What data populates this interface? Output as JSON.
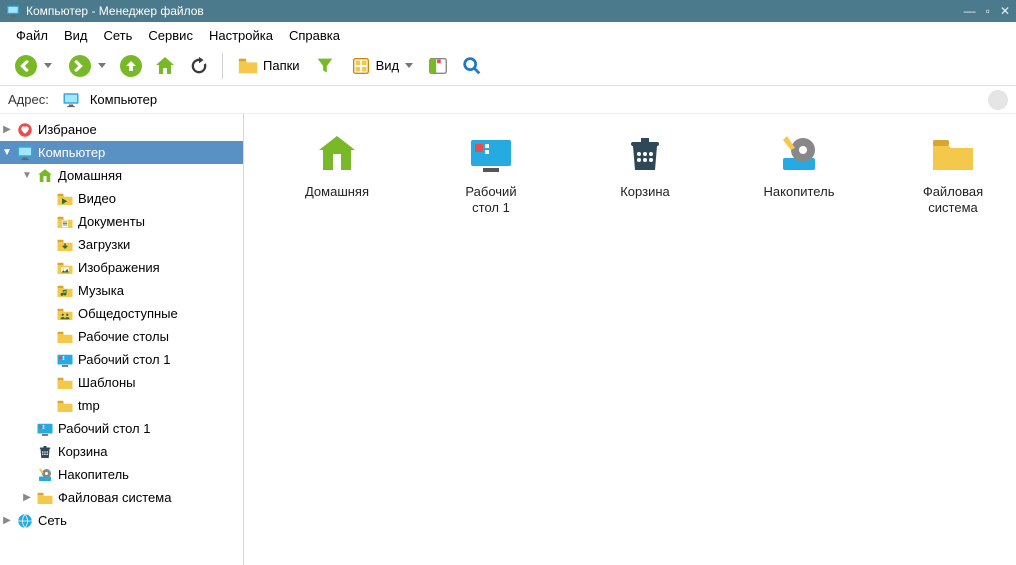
{
  "titlebar": {
    "title": "Компьютер  - Менеджер файлов"
  },
  "menu": {
    "file": "Файл",
    "view": "Вид",
    "net": "Сеть",
    "service": "Сервис",
    "settings": "Настройка",
    "help": "Справка"
  },
  "toolbar": {
    "folders": "Папки",
    "view": "Вид"
  },
  "address": {
    "label": "Адрес:",
    "value": "Компьютер"
  },
  "tree": {
    "favorites": "Избраное",
    "computer": "Компьютер",
    "home": "Домашняя",
    "video": "Видео",
    "documents": "Документы",
    "downloads": "Загрузки",
    "pictures": "Изображения",
    "music": "Музыка",
    "public": "Общедоступные",
    "desktops": "Рабочие столы",
    "desktop1": "Рабочий стол 1",
    "templates": "Шаблоны",
    "tmp": "tmp",
    "desktop1b": "Рабочий стол 1",
    "trash": "Корзина",
    "storage": "Накопитель",
    "filesystem": "Файловая система",
    "network": "Сеть"
  },
  "items": {
    "home": "Домашняя",
    "desktop1_line1": "Рабочий",
    "desktop1_line2": "стол 1",
    "trash": "Корзина",
    "storage": "Накопитель",
    "fs_line1": "Файловая",
    "fs_line2": "система"
  }
}
